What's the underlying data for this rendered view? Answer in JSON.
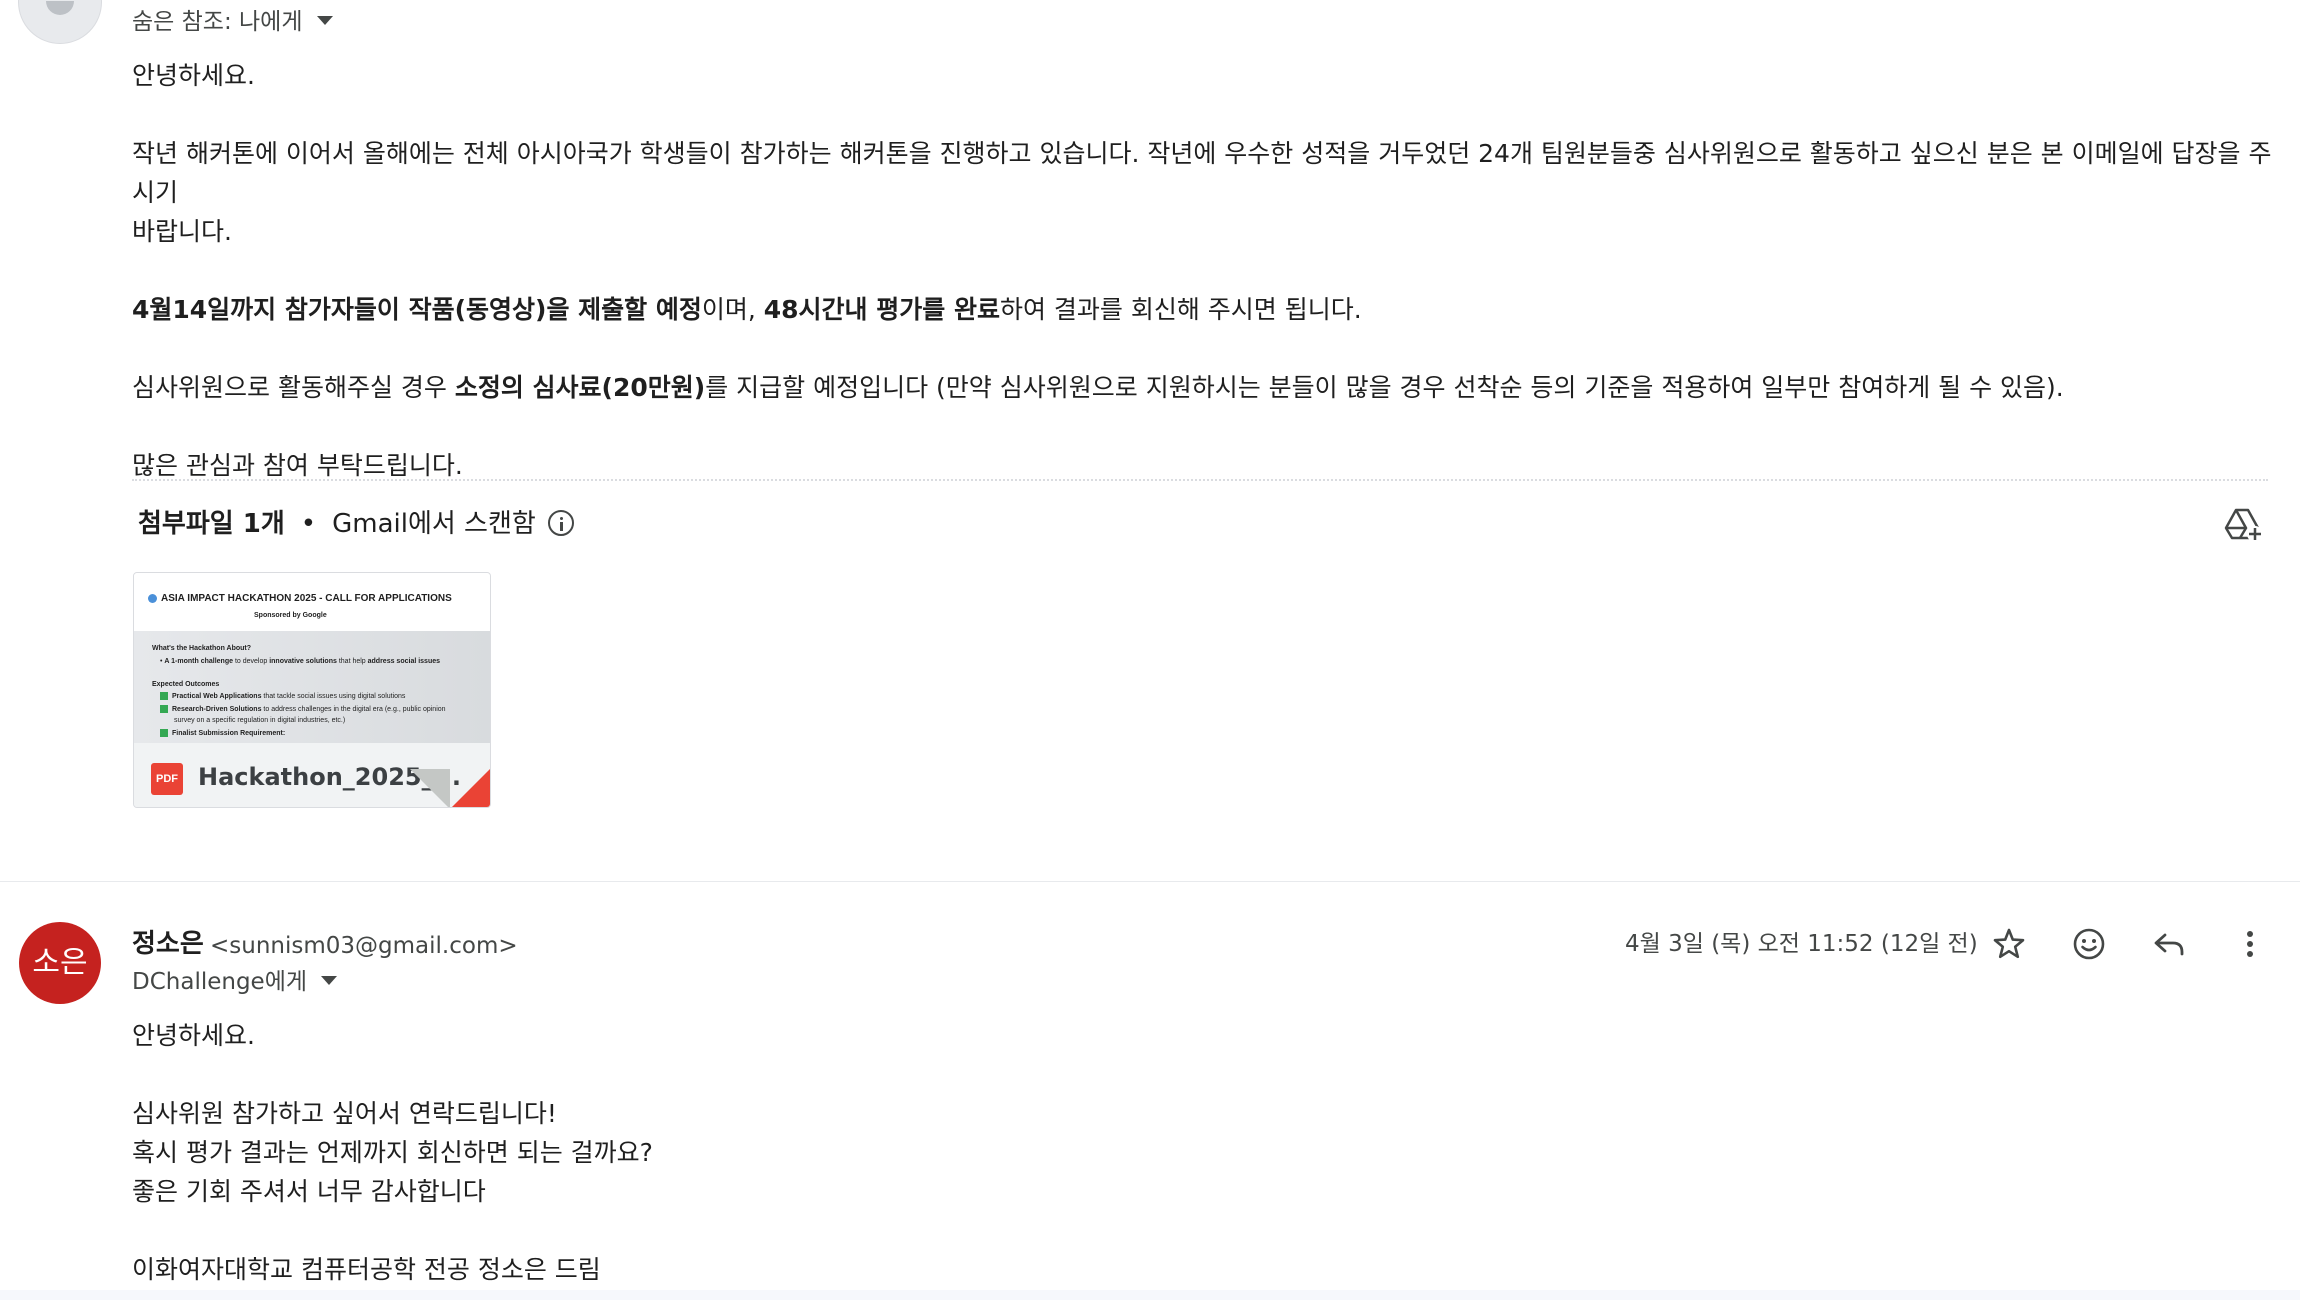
{
  "message_top": {
    "bcc_line": "숨은 참조: 나에게",
    "body": {
      "greeting": "안녕하세요.",
      "para1": "작년 해커톤에 이어서 올해에는 전체 아시아국가 학생들이 참가하는 해커톤을 진행하고 있습니다. 작년에 우수한 성적을 거두었던 24개 팀원분들중 심사위원으로 활동하고 싶으신 분은 본 이메일에 답장을 주시기",
      "para1_cont": "바랍니다.",
      "para2_bold1": "4월14일까지 참가자들이 작품(동영상)을 제출할 예정",
      "para2_mid": "이며, ",
      "para2_bold2": "48시간내 평가를 완료",
      "para2_end": "하여 결과를 회신해 주시면 됩니다.",
      "para3_start": "심사위원으로 활동해주실 경우 ",
      "para3_bold": "소정의 심사료(20만원)",
      "para3_end": "를 지급할 예정입니다 (만약 심사위원으로 지원하시는 분들이 많을 경우 선착순 등의 기준을 적용하여 일부만 참여하게 될 수 있음).",
      "closing": "많은 관심과 참여 부탁드립니다."
    },
    "attachments": {
      "count_label": "첨부파일 1개",
      "separator": "•",
      "scan_label": "Gmail에서 스캔함",
      "file": {
        "name": "Hackathon_2025_...",
        "type_badge": "PDF",
        "preview": {
          "title": "ASIA IMPACT HACKATHON 2025 - CALL FOR APPLICATIONS",
          "sponsor": "Sponsored by Google",
          "q1": "What's the Hackathon About?",
          "q1_item_a": "A 1-month challenge",
          "q1_item_b": " to develop ",
          "q1_item_c": "innovative solutions",
          "q1_item_d": " that help ",
          "q1_item_e": "address social issues",
          "q2": "Expected Outcomes",
          "o1_bold": "Practical Web Applications",
          "o1_rest": " that tackle social issues using digital solutions",
          "o2_bold": "Research-Driven Solutions",
          "o2_rest": " to address challenges in the digital era (e.g., public opinion",
          "o2_rest2": "survey on a specific regulation in digital industries, etc.)",
          "o3_bold": "Finalist Submission Requirement:"
        }
      }
    }
  },
  "message_reply": {
    "avatar_text": "소은",
    "sender_name": "정소은",
    "sender_email": "<sunnism03@gmail.com>",
    "recipient": "DChallenge에게",
    "date": "4월 3일 (목) 오전 11:52 (12일 전)",
    "icons": {
      "star": "star-icon",
      "emoji": "emoji-icon",
      "reply": "reply-icon",
      "more": "more-vert-icon"
    },
    "body": {
      "greeting": "안녕하세요.",
      "line1": "심사위원 참가하고 싶어서 연락드립니다!",
      "line2": "혹시 평가 결과는 언제까지 회신하면 되는 걸까요?",
      "line3": "좋은 기회 주셔서 너무 감사합니다",
      "signature": "이화여자대학교 컴퓨터공학 전공 정소은 드림"
    }
  },
  "colors": {
    "avatar_reply": "#c5221f",
    "pdf_red": "#ea4335",
    "text_primary": "#1f1f1f",
    "text_secondary": "#444746"
  }
}
